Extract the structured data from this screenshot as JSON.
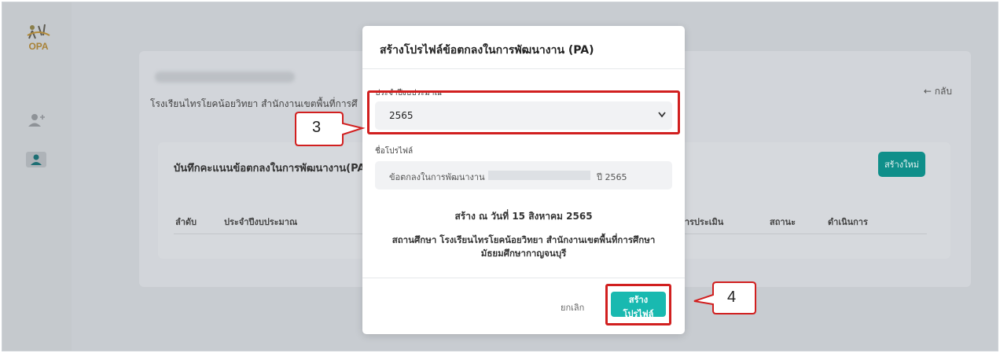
{
  "app": {
    "logo_text": "OPA",
    "school_line": "โรงเรียนไทรโยคน้อยวิทยา สำนักงานเขตพื้นที่การศึ",
    "back_label": "← กลับ",
    "section_title": "บันทึกคะแนนข้อตกลงในการพัฒนางาน(PA",
    "new_button": "สร้างใหม่",
    "table_headers": [
      "ลำดับ",
      "ประจำปีงบประมาณ",
      "ผลการประเมิน",
      "สถานะ",
      "ดำเนินการ"
    ]
  },
  "modal": {
    "title": "สร้างโปรไฟล์ข้อตกลงในการพัฒนางาน (PA)",
    "budget_year_label": "ประจำปีงบประมาณ",
    "budget_year_value": "2565",
    "profile_name_label": "ชื่อโปรไฟล์",
    "profile_name_prefix": "ข้อตกลงในการพัฒนางาน",
    "profile_name_suffix": "ปี 2565",
    "created_text": "สร้าง ณ วันที่ 15 สิงหาคม 2565",
    "institution_line1": "สถานศึกษา โรงเรียนไทรโยคน้อยวิทยา สำนักงานเขตพื้นที่การศึกษา",
    "institution_line2": "มัธยมศึกษากาญจนบุรี",
    "cancel_label": "ยกเลิก",
    "create_label": "สร้างโปรไฟล์"
  },
  "annotations": {
    "step_3": "3",
    "step_4": "4",
    "highlight_color": "#d11f1f"
  },
  "colors": {
    "primary": "#19b9b0",
    "overlay": "#c8ccd1"
  }
}
